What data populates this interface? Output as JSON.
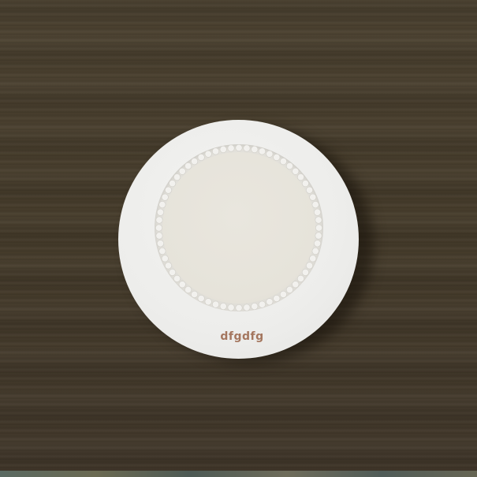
{
  "scene": {
    "plate_label": "dfgdfg"
  },
  "colors": {
    "table": "#463c2b",
    "plate": "#ededeb",
    "plate_center": "#e6e3da",
    "label": "#a4765e"
  }
}
